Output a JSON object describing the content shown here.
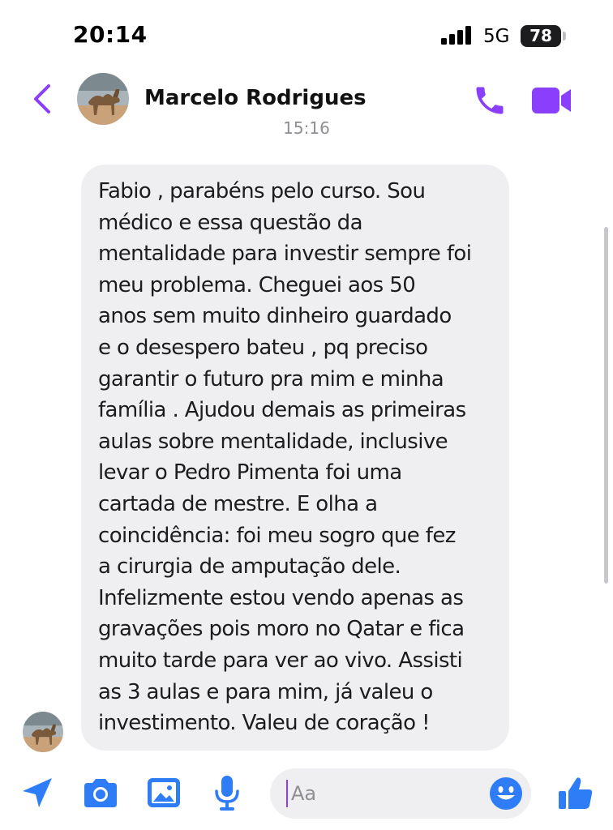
{
  "status_bar": {
    "time": "20:14",
    "network": "5G",
    "battery": "78"
  },
  "header": {
    "contact_name": "Marcelo Rodrigues"
  },
  "conversation": {
    "timestamp": "15:16",
    "message": "Fabio , parabéns pelo curso. Sou\nmédico e essa questão da\nmentalidade para investir sempre foi\nmeu problema. Cheguei aos 50\nanos sem muito dinheiro guardado\ne o desespero bateu , pq preciso\ngarantir o futuro pra mim e minha\nfamília . Ajudou demais as primeiras\naulas sobre mentalidade, inclusive\nlevar o Pedro Pimenta foi uma\ncartada de mestre. E olha a\ncoincidência: foi meu sogro que fez\na cirurgia de amputação dele.\nInfelizmente estou vendo apenas as\ngravações pois moro no Qatar e fica\nmuito tarde para ver ao vivo. Assisti\nas 3 aulas e para mim, já valeu o\ninvestimento. Valeu de coração !"
  },
  "composer": {
    "placeholder": "Aa"
  },
  "colors": {
    "accent": "#8a3ffc",
    "blue": "#2e7cf6",
    "bubble": "#efeff1"
  },
  "icons": [
    "back-chevron-icon",
    "phone-icon",
    "video-camera-icon",
    "location-arrow-icon",
    "camera-icon",
    "image-icon",
    "microphone-icon",
    "emoji-icon",
    "thumbs-up-icon"
  ]
}
